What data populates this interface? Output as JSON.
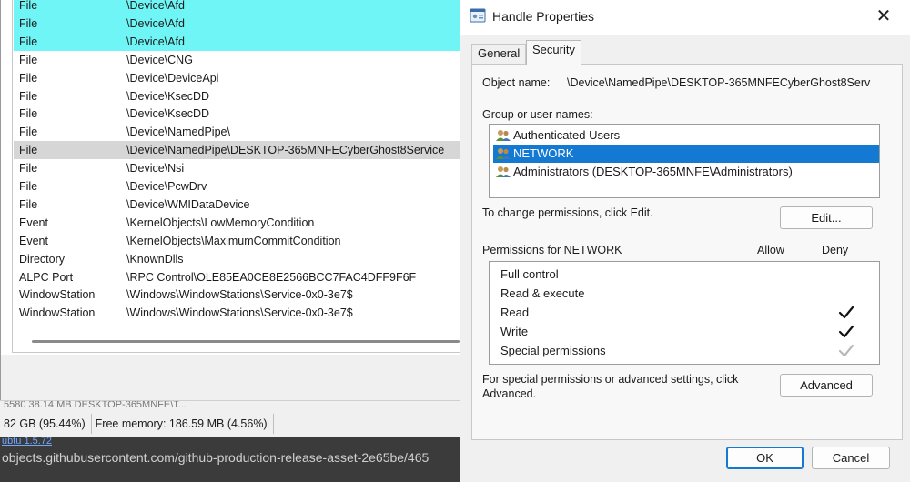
{
  "handles": {
    "rows": [
      {
        "type": "File",
        "name": "\\Device\\Afd",
        "hl": "cyan"
      },
      {
        "type": "File",
        "name": "\\Device\\Afd",
        "hl": "cyan"
      },
      {
        "type": "File",
        "name": "\\Device\\Afd",
        "hl": "cyan"
      },
      {
        "type": "File",
        "name": "\\Device\\CNG",
        "hl": ""
      },
      {
        "type": "File",
        "name": "\\Device\\DeviceApi",
        "hl": ""
      },
      {
        "type": "File",
        "name": "\\Device\\KsecDD",
        "hl": ""
      },
      {
        "type": "File",
        "name": "\\Device\\KsecDD",
        "hl": ""
      },
      {
        "type": "File",
        "name": "\\Device\\NamedPipe\\",
        "hl": ""
      },
      {
        "type": "File",
        "name": "\\Device\\NamedPipe\\DESKTOP-365MNFECyberGhost8Service",
        "hl": "sel"
      },
      {
        "type": "File",
        "name": "\\Device\\Nsi",
        "hl": ""
      },
      {
        "type": "File",
        "name": "\\Device\\PcwDrv",
        "hl": ""
      },
      {
        "type": "File",
        "name": "\\Device\\WMIDataDevice",
        "hl": ""
      },
      {
        "type": "Event",
        "name": "\\KernelObjects\\LowMemoryCondition",
        "hl": ""
      },
      {
        "type": "Event",
        "name": "\\KernelObjects\\MaximumCommitCondition",
        "hl": ""
      },
      {
        "type": "Directory",
        "name": "\\KnownDlls",
        "hl": ""
      },
      {
        "type": "ALPC Port",
        "name": "\\RPC Control\\OLE85EA0CE8E2566BCC7FAC4DFF9F6F",
        "hl": ""
      },
      {
        "type": "WindowStation",
        "name": "\\Windows\\WindowStations\\Service-0x0-3e7$",
        "hl": ""
      },
      {
        "type": "WindowStation",
        "name": "\\Windows\\WindowStations\\Service-0x0-3e7$",
        "hl": ""
      }
    ]
  },
  "statusbar": {
    "partial_row": "5580          38.14 MB    DESKTOP-365MNFE\\T...",
    "physical_memory": "82 GB (95.44%)",
    "free_memory": "Free memory: 186.59 MB (4.56%)"
  },
  "browser": {
    "partial_link": "ubtu 1.5.72",
    "url": "objects.githubusercontent.com/github-production-release-asset-2e65be/465"
  },
  "dialog": {
    "title": "Handle Properties",
    "close_glyph": "✕",
    "tabs": [
      {
        "label": "General",
        "active": false
      },
      {
        "label": "Security",
        "active": true
      }
    ],
    "object_name_label": "Object name:",
    "object_name_value": "\\Device\\NamedPipe\\DESKTOP-365MNFECyberGhost8Serv",
    "group_label": "Group or user names:",
    "groups": [
      {
        "name": "Authenticated Users",
        "selected": false,
        "icon": "users-icon"
      },
      {
        "name": "NETWORK",
        "selected": true,
        "icon": "users-icon"
      },
      {
        "name": "Administrators (DESKTOP-365MNFE\\Administrators)",
        "selected": false,
        "icon": "users-icon"
      }
    ],
    "change_hint": "To change permissions, click Edit.",
    "edit_button": "Edit...",
    "permissions_label": "Permissions for NETWORK",
    "allow_header": "Allow",
    "deny_header": "Deny",
    "permissions": [
      {
        "name": "Full control",
        "allow": false,
        "deny": false,
        "deny_dimmed": false
      },
      {
        "name": "Read & execute",
        "allow": false,
        "deny": false,
        "deny_dimmed": false
      },
      {
        "name": "Read",
        "allow": false,
        "deny": true,
        "deny_dimmed": false
      },
      {
        "name": "Write",
        "allow": false,
        "deny": true,
        "deny_dimmed": false
      },
      {
        "name": "Special permissions",
        "allow": false,
        "deny": true,
        "deny_dimmed": true
      }
    ],
    "advanced_hint_line1": "For special permissions or advanced settings, click",
    "advanced_hint_line2": "Advanced.",
    "advanced_button": "Advanced",
    "ok_button": "OK",
    "cancel_button": "Cancel"
  },
  "colors": {
    "highlight_cyan": "#6ff5f5",
    "selection_blue": "#1379d3",
    "row_selected_grey": "#d6d6d6",
    "check_black": "#111111",
    "check_dimmed": "#b8b8b8"
  }
}
